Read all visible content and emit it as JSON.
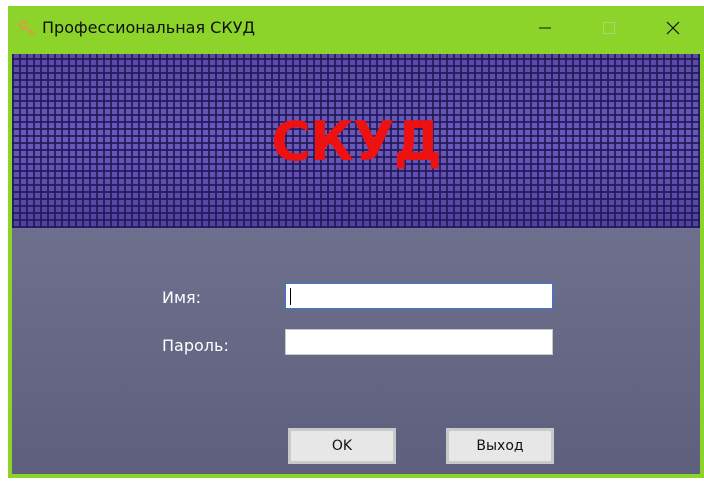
{
  "window": {
    "title": "Профессиональная СКУД",
    "icon": "keys-icon",
    "controls": {
      "minimize": "minimize-icon",
      "maximize": "maximize-icon",
      "close": "close-icon"
    }
  },
  "banner": {
    "title": "СКУД",
    "title_color": "#ee1111"
  },
  "form": {
    "name_label": "Имя:",
    "name_value": "",
    "password_label": "Пароль:",
    "password_value": ""
  },
  "buttons": {
    "ok_label": "OK",
    "exit_label": "Выход"
  },
  "colors": {
    "titlebar": "#8dd42a",
    "banner": "#4e3f9a",
    "panel": "#6a6c89"
  }
}
